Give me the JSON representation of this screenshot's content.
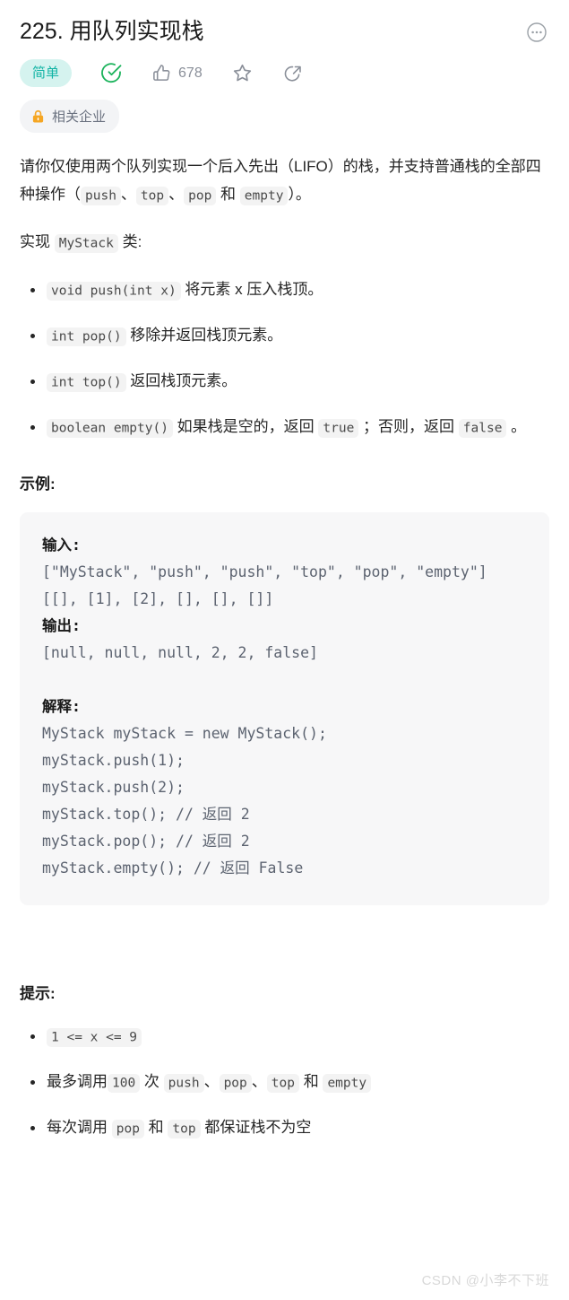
{
  "header": {
    "title": "225. 用队列实现栈",
    "more_icon": "more-horizontal-circle-icon"
  },
  "meta": {
    "difficulty": "简单",
    "solved_icon": "check-circle-icon",
    "like_icon": "thumbs-up-icon",
    "like_count": "678",
    "favorite_icon": "star-icon",
    "share_icon": "share-icon"
  },
  "enterprise_tag": {
    "lock_icon": "lock-icon",
    "label": "相关企业"
  },
  "description": {
    "intro_1": "请你仅使用两个队列实现一个后入先出（LIFO）的栈，并支持普通栈的全部四种操作（",
    "op_push": "push",
    "sep_1": "、",
    "op_top": "top",
    "sep_2": "、",
    "op_pop": "pop",
    "conj": " 和 ",
    "op_empty": "empty",
    "intro_2": "）。",
    "class_line_pre": "实现 ",
    "class_name": "MyStack",
    "class_line_post": " 类:",
    "methods": [
      {
        "signature": "void push(int x)",
        "text": " 将元素 x 压入栈顶。"
      },
      {
        "signature": "int pop()",
        "text": " 移除并返回栈顶元素。"
      },
      {
        "signature": "int top()",
        "text": " 返回栈顶元素。"
      }
    ],
    "empty_method": {
      "signature": "boolean empty()",
      "text_a": " 如果栈是空的，返回 ",
      "code_true": "true",
      "text_b": " ；否则，返回 ",
      "code_false": "false",
      "text_c": " 。"
    }
  },
  "example": {
    "heading": "示例:",
    "input_label": "输入:",
    "input_lines": [
      "[\"MyStack\", \"push\", \"push\", \"top\", \"pop\", \"empty\"]",
      "[[], [1], [2], [], [], []]"
    ],
    "output_label": "输出:",
    "output_lines": [
      "[null, null, null, 2, 2, false]"
    ],
    "explain_label": "解释:",
    "explain_lines": [
      "MyStack myStack = new MyStack();",
      "myStack.push(1);",
      "myStack.push(2);",
      "myStack.top(); // 返回 2",
      "myStack.pop(); // 返回 2",
      "myStack.empty(); // 返回 False"
    ]
  },
  "hints": {
    "heading": "提示:",
    "item1_code": "1 <= x <= 9",
    "item2": {
      "pre": "最多调用",
      "count": "100",
      "mid": " 次 ",
      "c1": "push",
      "s1": "、",
      "c2": "pop",
      "s2": "、",
      "c3": "top",
      "conj": " 和 ",
      "c4": "empty"
    },
    "item3": {
      "pre": "每次调用 ",
      "c1": "pop",
      "conj": " 和 ",
      "c2": "top",
      "post": " 都保证栈不为空"
    }
  },
  "watermark": "CSDN @小李不下班",
  "colors": {
    "difficulty_bg": "#d5f3ef",
    "difficulty_text": "#12b4a5",
    "solved_green": "#1cb35c",
    "lock_orange": "#f5a623",
    "code_bg": "#f7f7f8",
    "inline_code_bg": "#f3f3f3",
    "watermark": "#d8d8d8"
  }
}
